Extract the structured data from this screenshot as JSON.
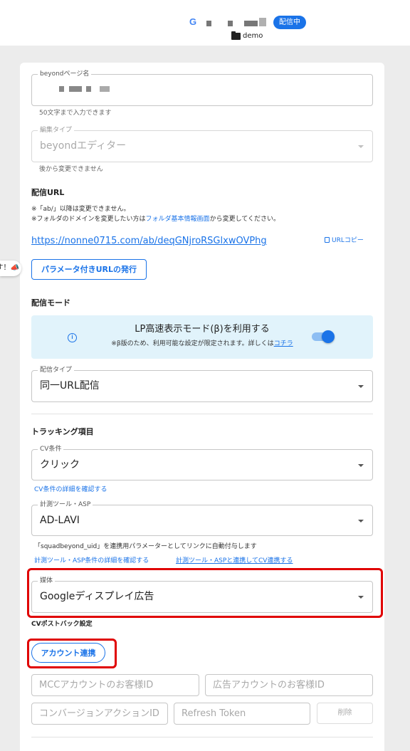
{
  "header": {
    "google_logo": "G",
    "status_badge": "配信中",
    "folder_icon": "folder-icon",
    "folder_name": "demo"
  },
  "flyout": {
    "text": "す！📣"
  },
  "page_name": {
    "label": "beyondページ名",
    "help": "50文字まで入力できます"
  },
  "edit_type": {
    "label": "編集タイプ",
    "value": "beyondエディター",
    "help": "後から変更できません"
  },
  "delivery_url": {
    "heading": "配信URL",
    "note1": "※「ab/」以降は変更できません。",
    "note2_before": "※フォルダのドメインを変更したい方は",
    "note2_link": "フォルダ基本情報画面",
    "note2_after": "から変更してください。",
    "url": "https://nonne0715.com/ab/deqGNjroRSGlxwOVPhg",
    "copy_label": "URLコピー",
    "param_button": "パラメータ付きURLの発行"
  },
  "delivery_mode": {
    "heading": "配信モード",
    "banner_title": "LP高速表示モード(β)を利用する",
    "banner_sub_before": "※β版のため、利用可能な設定が限定されます。詳しくは",
    "banner_sub_link": "コチラ",
    "info_icon": "i",
    "toggle_on": true,
    "type_label": "配信タイプ",
    "type_value": "同一URL配信"
  },
  "tracking": {
    "heading": "トラッキング項目",
    "cv_label": "CV条件",
    "cv_value": "クリック",
    "cv_link": "CV条件の詳細を確認する",
    "tool_label": "計測ツール・ASP",
    "tool_value": "AD-LAVI",
    "tool_note": "「squadbeyond_uid」を連携用パラメーターとしてリンクに自動付与します",
    "tool_link1": "計測ツール・ASP条件の詳細を確認する",
    "tool_link2": "計測ツール・ASPと連携してCV連携する",
    "media_label": "媒体",
    "media_value": "Googleディスプレイ広告",
    "postback_heading": "CVポストバック設定",
    "account_button": "アカウント連携",
    "mcc_placeholder": "MCCアカウントのお客様ID",
    "ad_account_placeholder": "広告アカウントのお客様ID",
    "conversion_placeholder": "コンバージョンアクションID",
    "refresh_placeholder": "Refresh Token",
    "delete_button": "削除"
  },
  "highlight_color": "#e00000",
  "accent_color": "#1a73e8"
}
